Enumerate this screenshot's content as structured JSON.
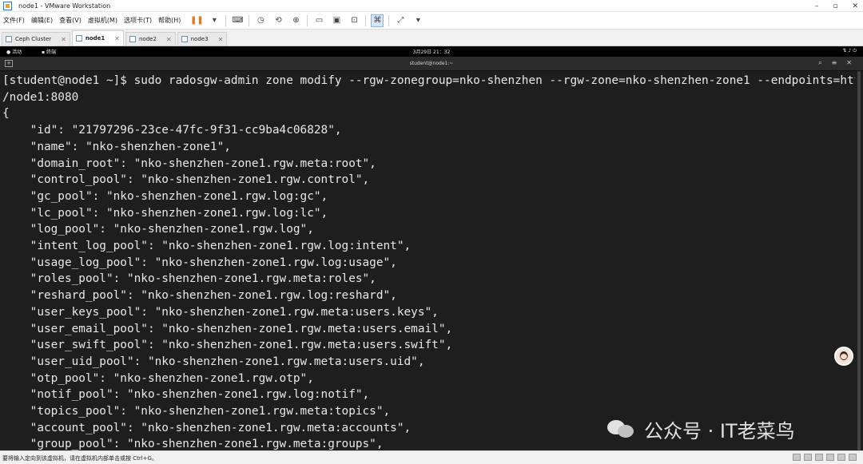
{
  "window": {
    "title": "node1 - VMware Workstation",
    "controls": [
      "–",
      "▫",
      "✕"
    ]
  },
  "menu": [
    "文件(F)",
    "编辑(E)",
    "查看(V)",
    "虚拟机(M)",
    "选项卡(T)",
    "帮助(H)"
  ],
  "tabs": [
    {
      "label": "Ceph Cluster",
      "active": false
    },
    {
      "label": "node1",
      "active": true
    },
    {
      "label": "node2",
      "active": false
    },
    {
      "label": "node3",
      "active": false
    }
  ],
  "gnome": {
    "activities": "活动",
    "app": "终端",
    "clock": "3月29日 21：32"
  },
  "terminal": {
    "title": "student@node1:~",
    "lines": [
      "[student@node1 ~]$ sudo radosgw-admin zone modify --rgw-zonegroup=nko-shenzhen --rgw-zone=nko-shenzhen-zone1 --endpoints=http:/",
      "/node1:8080",
      "{",
      "    \"id\": \"21797296-23ce-47fc-9f31-cc9ba4c06828\",",
      "    \"name\": \"nko-shenzhen-zone1\",",
      "    \"domain_root\": \"nko-shenzhen-zone1.rgw.meta:root\",",
      "    \"control_pool\": \"nko-shenzhen-zone1.rgw.control\",",
      "    \"gc_pool\": \"nko-shenzhen-zone1.rgw.log:gc\",",
      "    \"lc_pool\": \"nko-shenzhen-zone1.rgw.log:lc\",",
      "    \"log_pool\": \"nko-shenzhen-zone1.rgw.log\",",
      "    \"intent_log_pool\": \"nko-shenzhen-zone1.rgw.log:intent\",",
      "    \"usage_log_pool\": \"nko-shenzhen-zone1.rgw.log:usage\",",
      "    \"roles_pool\": \"nko-shenzhen-zone1.rgw.meta:roles\",",
      "    \"reshard_pool\": \"nko-shenzhen-zone1.rgw.log:reshard\",",
      "    \"user_keys_pool\": \"nko-shenzhen-zone1.rgw.meta:users.keys\",",
      "    \"user_email_pool\": \"nko-shenzhen-zone1.rgw.meta:users.email\",",
      "    \"user_swift_pool\": \"nko-shenzhen-zone1.rgw.meta:users.swift\",",
      "    \"user_uid_pool\": \"nko-shenzhen-zone1.rgw.meta:users.uid\",",
      "    \"otp_pool\": \"nko-shenzhen-zone1.rgw.otp\",",
      "    \"notif_pool\": \"nko-shenzhen-zone1.rgw.log:notif\",",
      "    \"topics_pool\": \"nko-shenzhen-zone1.rgw.meta:topics\",",
      "    \"account_pool\": \"nko-shenzhen-zone1.rgw.meta:accounts\",",
      "    \"group_pool\": \"nko-shenzhen-zone1.rgw.meta:groups\","
    ]
  },
  "watermark": "公众号 · IT老菜鸟",
  "statusbar": {
    "hint": "要将输入定向到该虚拟机，请在虚拟机内部单击或按 Ctrl+G。"
  }
}
